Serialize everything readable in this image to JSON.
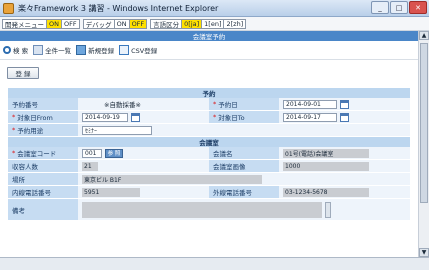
{
  "window": {
    "title": "楽々Framework 3 講習 - Windows Internet Explorer",
    "min_label": "_",
    "max_label": "□",
    "close_label": "✕"
  },
  "header": {
    "dev_menu_label": "開発メニュー",
    "dev_menu_on": "ON",
    "dev_menu_off": "OFF",
    "debug_label": "デバッグ",
    "debug_on": "ON",
    "debug_off": "OFF",
    "lang_label": "言語区分",
    "lang_options": [
      "0[ja]",
      "1[en]",
      "2[zh]"
    ]
  },
  "page": {
    "title": "会議室予約"
  },
  "toolbar": {
    "items": [
      {
        "label": "検 索",
        "icon": "search-icon"
      },
      {
        "label": "全件一覧",
        "icon": "list-icon"
      },
      {
        "label": "新規登録",
        "icon": "new-record-icon"
      },
      {
        "label": "CSV登録",
        "icon": "csv-icon"
      }
    ]
  },
  "register_button": "登 録",
  "form": {
    "sections": {
      "reservation": "予約",
      "room": "会議室"
    },
    "reservation_no": {
      "label": "予約番号",
      "value": "※自動採番※"
    },
    "reservation_date": {
      "label": "予約日",
      "value": "2014-09-01"
    },
    "date_from": {
      "label": "対象日From",
      "value": "2014-09-19"
    },
    "date_to": {
      "label": "対象日To",
      "value": "2014-09-17"
    },
    "purpose": {
      "label": "予約用途",
      "value": "ｾﾐﾅｰ"
    },
    "room_code": {
      "label": "会議室コード",
      "value": "001",
      "ref_button": "参 照"
    },
    "room_name": {
      "label": "会議名",
      "value": "01号(電話)会議室"
    },
    "capacity": {
      "label": "収容人数",
      "value": "21"
    },
    "room_image": {
      "label": "会議室画像",
      "value": "1000"
    },
    "location": {
      "label": "場所",
      "value": "東京ビル B1F"
    },
    "ext_phone": {
      "label": "内線電話番号",
      "value": "5951"
    },
    "out_phone": {
      "label": "外線電話番号",
      "value": "03-1234-5678"
    },
    "remarks": {
      "label": "備考",
      "value": ""
    }
  },
  "colors": {
    "page_title_bg": "#4a86c8",
    "label_bg": "#c6dcf2",
    "toggle_on": "#ffe000"
  }
}
